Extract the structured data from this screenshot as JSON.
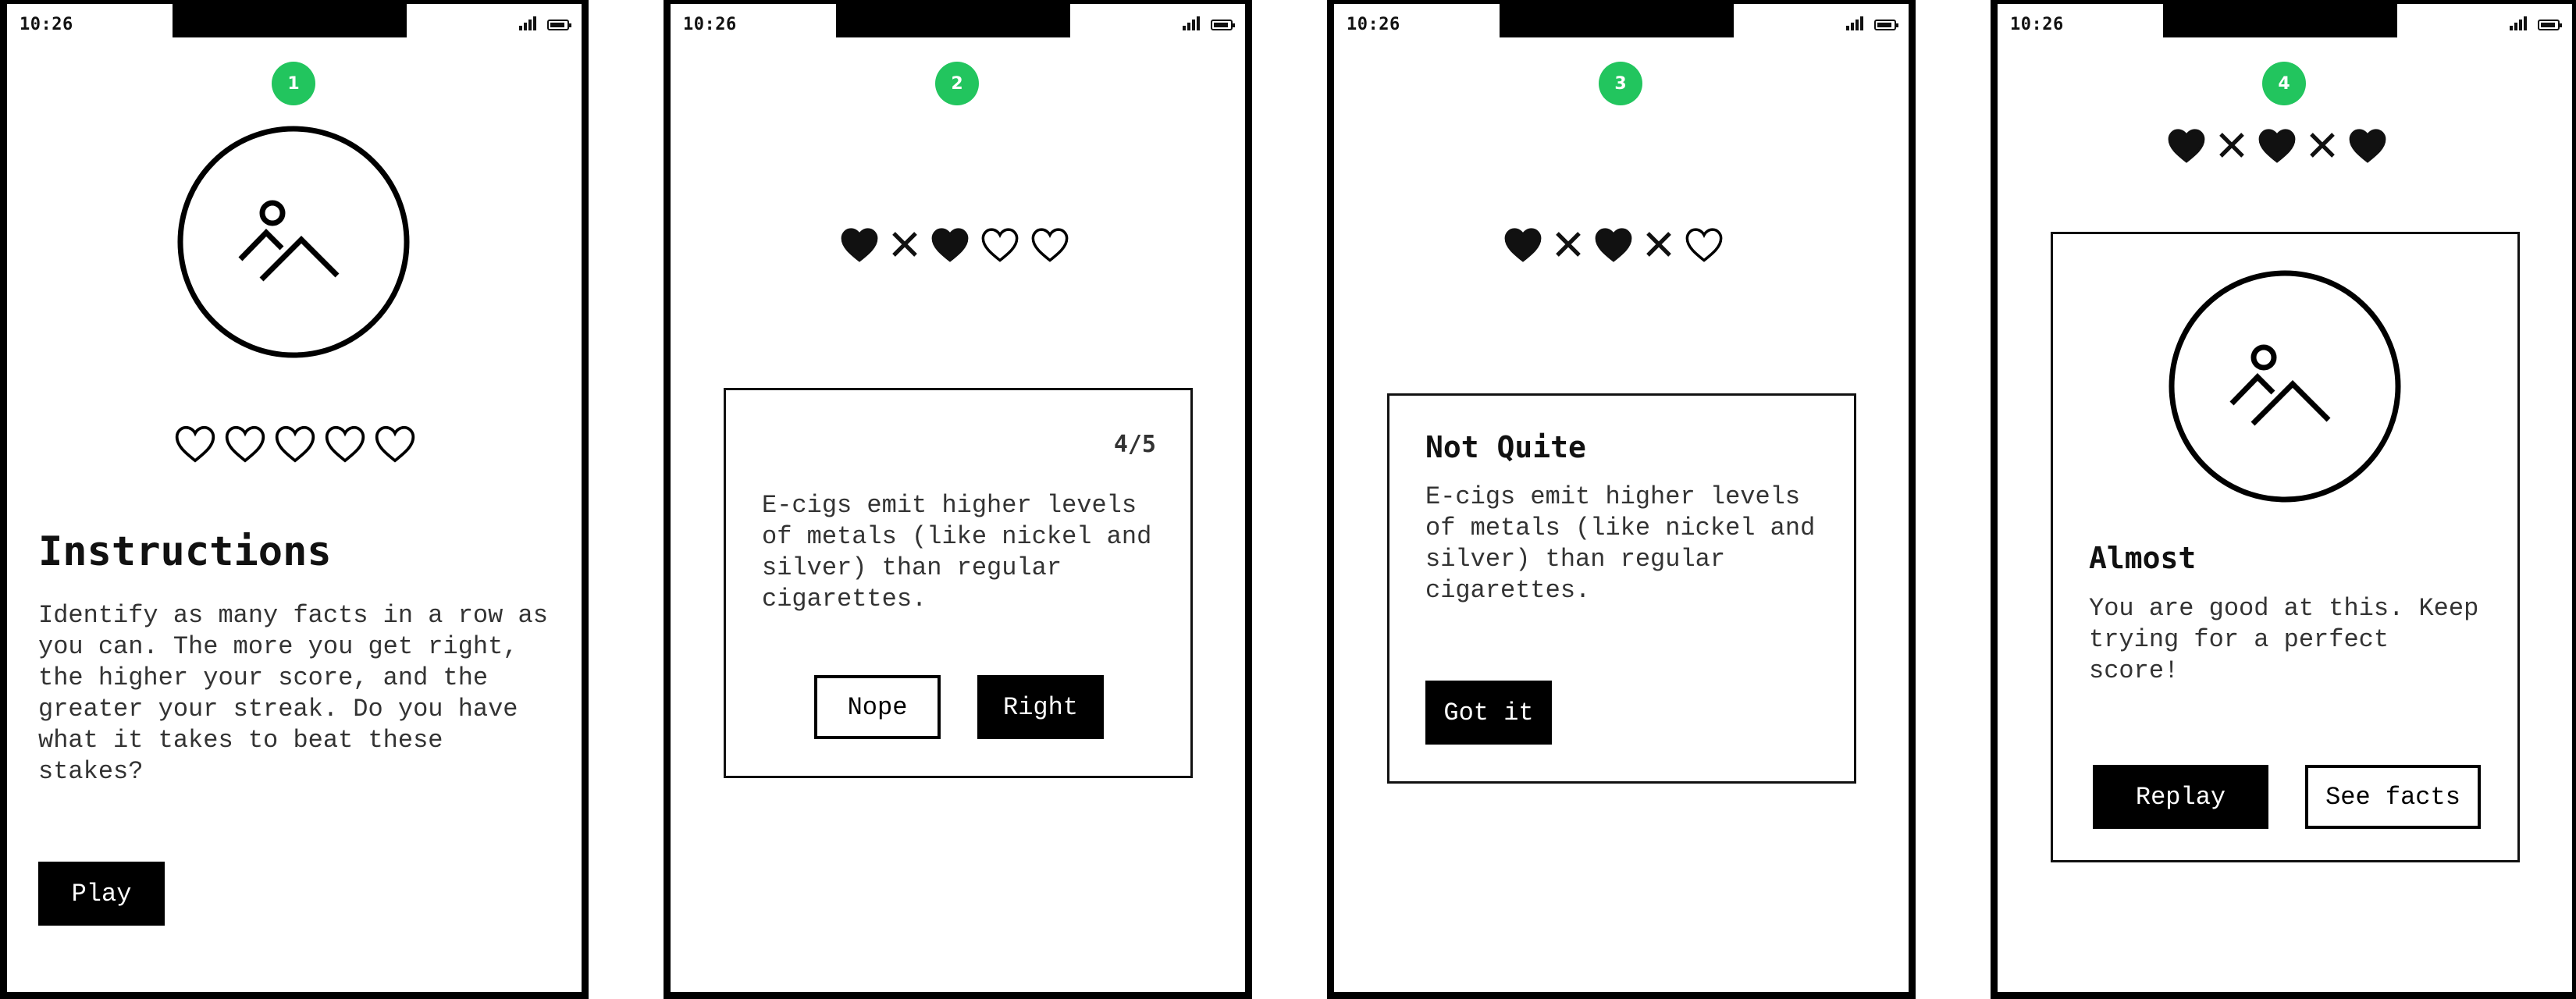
{
  "status_bar": {
    "time": "10:26"
  },
  "colors": {
    "accent": "#22c55e",
    "ink": "#000000",
    "paper": "#ffffff"
  },
  "screens": [
    {
      "step": "1",
      "hearts": [
        "empty",
        "empty",
        "empty",
        "empty",
        "empty"
      ],
      "title": "Instructions",
      "body": "Identify as many facts in a row as you can. The more you get right, the higher your score, and the greater your streak. Do you have what it takes to beat these stakes?",
      "button": "Play",
      "image_icon": "image-placeholder-icon"
    },
    {
      "step": "2",
      "hearts": [
        "filled",
        "x",
        "filled",
        "empty",
        "empty"
      ],
      "counter": "4/5",
      "fact": "E-cigs emit higher levels of metals (like nickel and silver) than regular cigarettes.",
      "buttons": {
        "nope": "Nope",
        "right": "Right"
      }
    },
    {
      "step": "3",
      "hearts": [
        "filled",
        "x",
        "filled",
        "x",
        "empty"
      ],
      "title": "Not Quite",
      "fact": "E-cigs emit higher levels of metals (like nickel and silver) than regular cigarettes.",
      "button": "Got it"
    },
    {
      "step": "4",
      "hearts": [
        "filled",
        "x",
        "filled",
        "x",
        "filled"
      ],
      "title": "Almost",
      "body": "You are good at this. Keep trying for a perfect score!",
      "buttons": {
        "replay": "Replay",
        "see_facts": "See facts"
      },
      "image_icon": "image-placeholder-icon"
    }
  ]
}
